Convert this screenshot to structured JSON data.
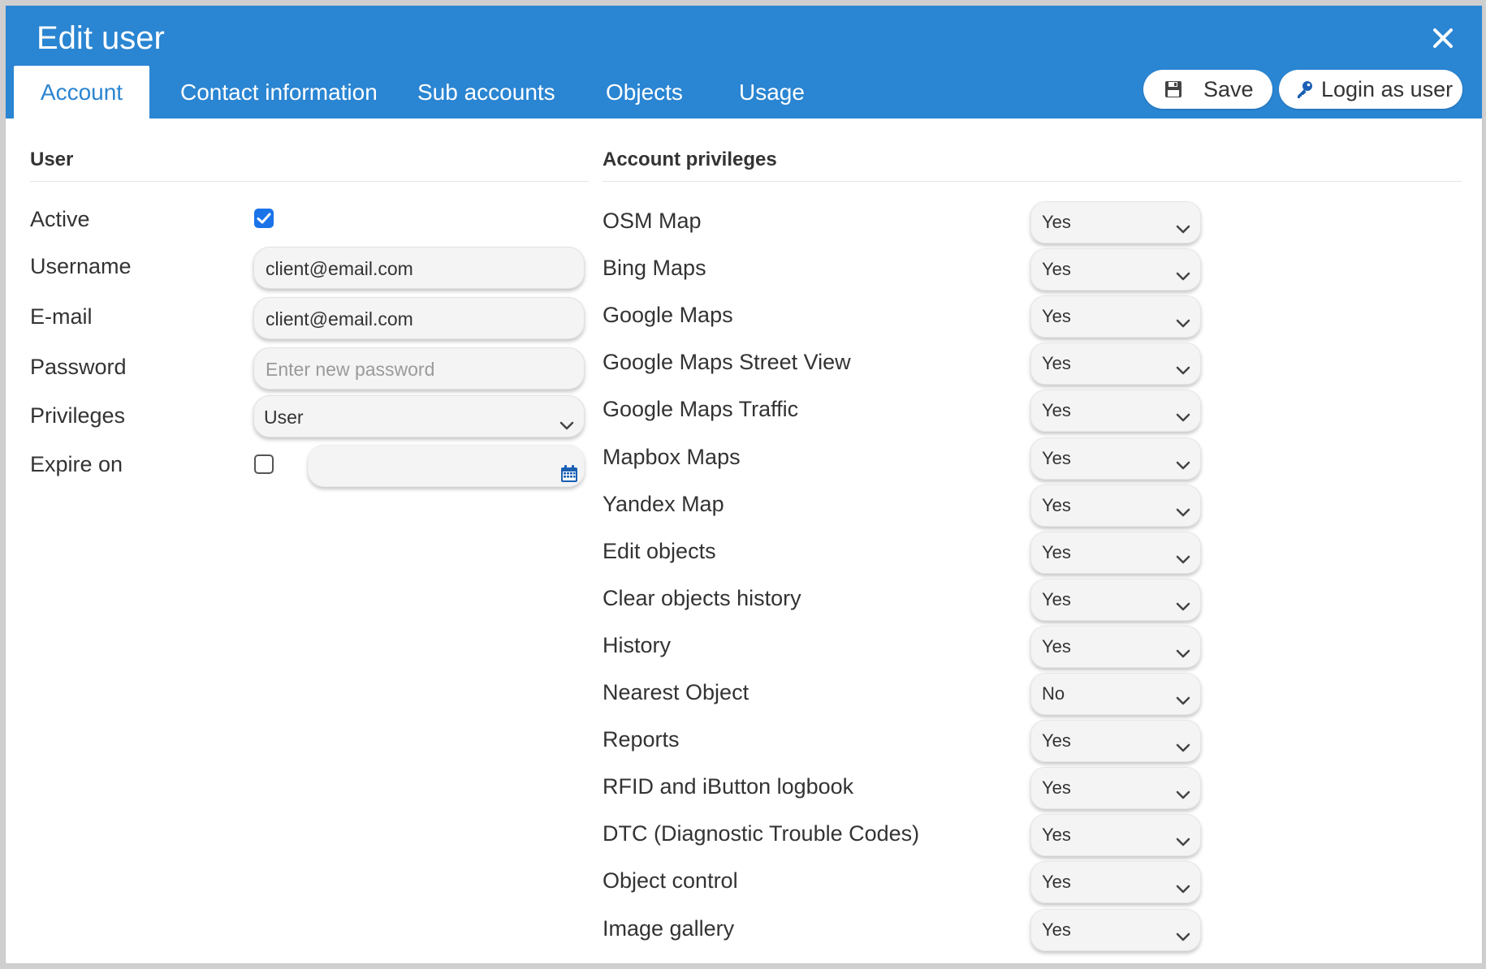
{
  "header": {
    "title": "Edit user",
    "tabs": [
      {
        "label": "Account",
        "active": true
      },
      {
        "label": "Contact information"
      },
      {
        "label": "Sub accounts"
      },
      {
        "label": "Objects"
      },
      {
        "label": "Usage"
      }
    ],
    "save_label": "Save",
    "login_label": "Login as user"
  },
  "user": {
    "section_title": "User",
    "active_label": "Active",
    "active_checked": true,
    "username_label": "Username",
    "username_value": "client@email.com",
    "email_label": "E-mail",
    "email_value": "client@email.com",
    "password_label": "Password",
    "password_placeholder": "Enter new password",
    "privileges_label": "Privileges",
    "privileges_value": "User",
    "expire_label": "Expire on",
    "expire_checked": false
  },
  "privileges": {
    "section_title": "Account privileges",
    "items": [
      {
        "label": "OSM Map",
        "value": "Yes"
      },
      {
        "label": "Bing Maps",
        "value": "Yes"
      },
      {
        "label": "Google Maps",
        "value": "Yes"
      },
      {
        "label": "Google Maps Street View",
        "value": "Yes"
      },
      {
        "label": "Google Maps Traffic",
        "value": "Yes"
      },
      {
        "label": "Mapbox Maps",
        "value": "Yes"
      },
      {
        "label": "Yandex Map",
        "value": "Yes"
      },
      {
        "label": "Edit objects",
        "value": "Yes"
      },
      {
        "label": "Clear objects history",
        "value": "Yes"
      },
      {
        "label": "History",
        "value": "Yes"
      },
      {
        "label": "Nearest Object",
        "value": "No"
      },
      {
        "label": "Reports",
        "value": "Yes"
      },
      {
        "label": "RFID and iButton logbook",
        "value": "Yes"
      },
      {
        "label": "DTC (Diagnostic Trouble Codes)",
        "value": "Yes"
      },
      {
        "label": "Object control",
        "value": "Yes"
      },
      {
        "label": "Image gallery",
        "value": "Yes"
      }
    ]
  },
  "colors": {
    "header_bg": "#2a85d2",
    "accent": "#1a73e8"
  }
}
